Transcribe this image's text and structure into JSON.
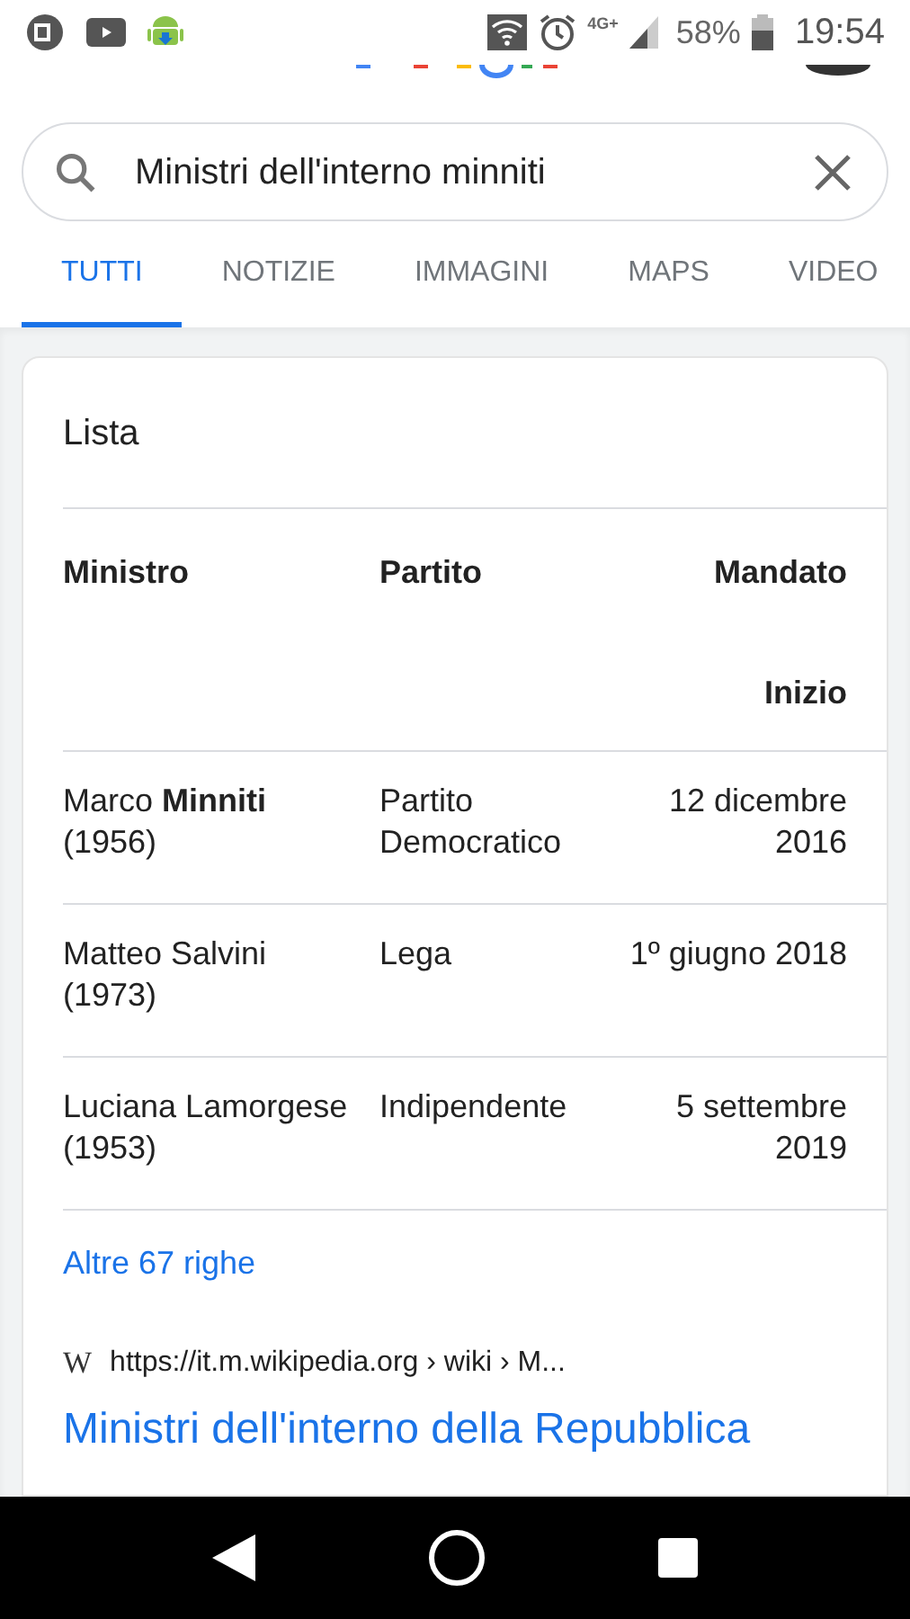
{
  "status_bar": {
    "network": "4G+",
    "battery": "58%",
    "time": "19:54"
  },
  "search": {
    "value": "Ministri dell'interno minniti"
  },
  "tabs": [
    {
      "label": "TUTTI",
      "selected": true
    },
    {
      "label": "NOTIZIE",
      "selected": false
    },
    {
      "label": "IMMAGINI",
      "selected": false
    },
    {
      "label": "MAPS",
      "selected": false
    },
    {
      "label": "VIDEO",
      "selected": false
    }
  ],
  "card": {
    "title": "Lista",
    "columns": [
      "Ministro",
      "Partito",
      "Mandato"
    ],
    "subheader": "Inizio",
    "rows": [
      {
        "minister": "Marco **Minniti**",
        "born": "(1956)",
        "party": "Partito Democratico",
        "start": "12 dicembre 2016"
      },
      {
        "minister": "Matteo Salvini",
        "born": "(1973)",
        "party": "Lega",
        "start": "1º giugno 2018"
      },
      {
        "minister": "Luciana Lamorgese",
        "born": "(1953)",
        "party": "Indipendente",
        "start": "5 settembre 2019"
      }
    ],
    "more_link": "Altre 67 righe",
    "result": {
      "favicon": "W",
      "url": "https://it.m.wikipedia.org › wiki › M...",
      "title": "Ministri dell'interno della Repubblica"
    }
  }
}
